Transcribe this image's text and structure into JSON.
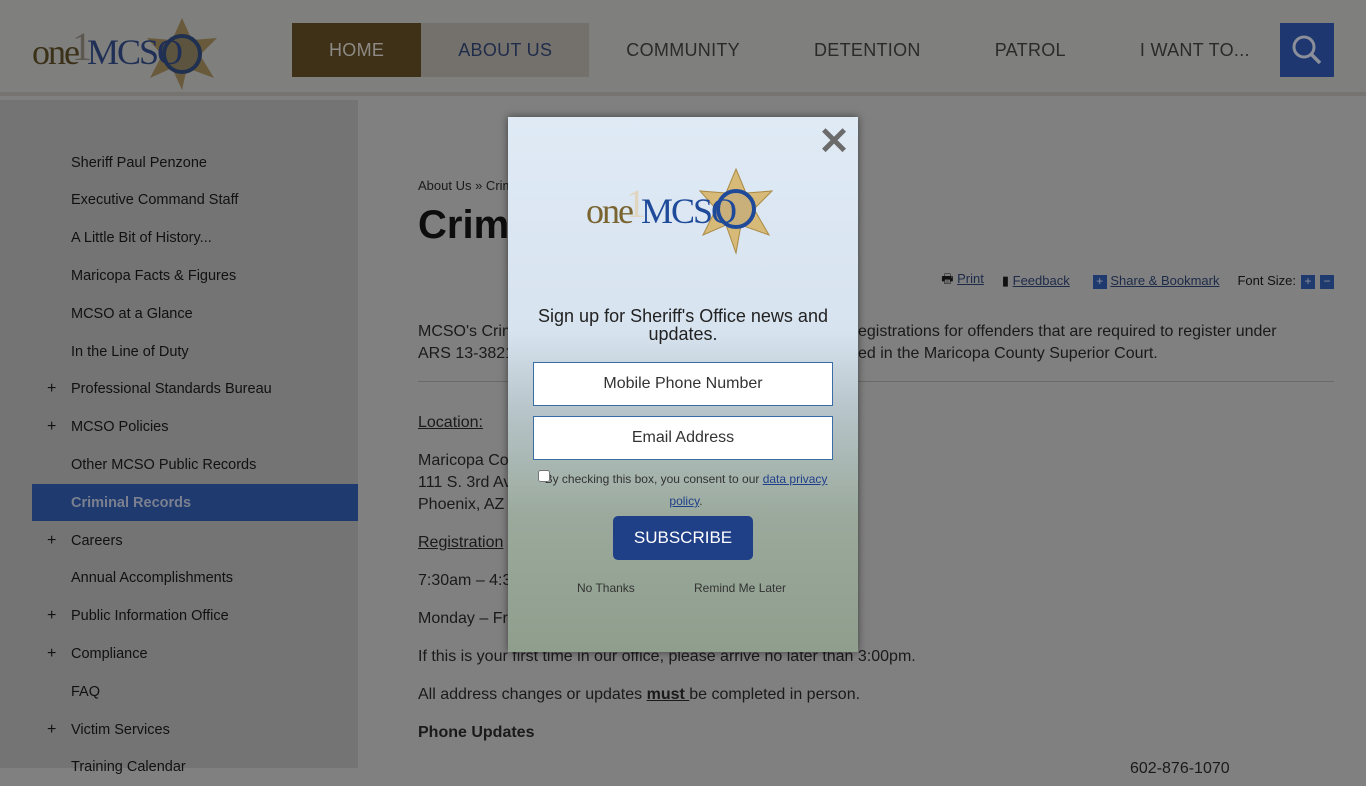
{
  "header": {
    "logo_text": "oneMCSO",
    "nav": [
      "HOME",
      "ABOUT US",
      "COMMUNITY",
      "DETENTION",
      "PATROL",
      "I WANT TO..."
    ],
    "search_icon": "search-icon"
  },
  "sidebar": {
    "items": [
      {
        "label": "Sheriff Paul Penzone",
        "expandable": false
      },
      {
        "label": "Executive Command Staff",
        "expandable": false
      },
      {
        "label": "A Little Bit of History...",
        "expandable": false
      },
      {
        "label": "Maricopa Facts & Figures",
        "expandable": false
      },
      {
        "label": "MCSO at a Glance",
        "expandable": false
      },
      {
        "label": "In the Line of Duty",
        "expandable": false
      },
      {
        "label": "Professional Standards Bureau",
        "expandable": true
      },
      {
        "label": "MCSO Policies",
        "expandable": true
      },
      {
        "label": "Other MCSO Public Records",
        "expandable": false
      },
      {
        "label": "Criminal Records",
        "expandable": false,
        "active": true
      },
      {
        "label": "Careers",
        "expandable": true
      },
      {
        "label": "Annual Accomplishments",
        "expandable": false
      },
      {
        "label": "Public Information Office",
        "expandable": true
      },
      {
        "label": "Compliance",
        "expandable": true
      },
      {
        "label": "FAQ",
        "expandable": false
      },
      {
        "label": "Victim Services",
        "expandable": true
      },
      {
        "label": "Training Calendar",
        "expandable": false
      }
    ],
    "plus": "+"
  },
  "main": {
    "breadcrumb": "About Us » Crim",
    "title": "Crim",
    "tools": {
      "print": "Print",
      "feedback": "Feedback",
      "share": "Share & Bookmark",
      "font_size": "Font Size:",
      "plus": "+",
      "minus": "−"
    },
    "intro_1a": "MCSO's Crim",
    "intro_1b": "egistrations for offenders that are required to register under",
    "intro_2a": "ARS 13-3821",
    "intro_2b": "ed in the Maricopa County Superior Court.",
    "location_label": "Location:",
    "address": [
      "Maricopa Co",
      "111 S. 3rd Av",
      "Phoenix, AZ"
    ],
    "registration_label": "Registration",
    "hours": "7:30am – 4:3",
    "days": "Monday – Fr",
    "first_time": "If this is your first time in our office, please arrive no later than 3:00pm.",
    "address_changes_pre": "All address changes or updates ",
    "address_changes_must": "must ",
    "address_changes_post": "be completed in person.",
    "phone_updates": "Phone Updates",
    "phone_line": "602-876-1070"
  },
  "modal": {
    "close": "✕",
    "logo_text": "oneMCSO",
    "heading": "Sign up for Sheriff's Office news and updates.",
    "phone_placeholder": "Mobile Phone Number",
    "email_placeholder": "Email Address",
    "consent_text": "By checking this box, you consent to our ",
    "consent_link": "data privacy policy",
    "consent_end": ".",
    "subscribe": "SUBSCRIBE",
    "no_thanks": "No Thanks",
    "remind_later": "Remind Me Later"
  }
}
